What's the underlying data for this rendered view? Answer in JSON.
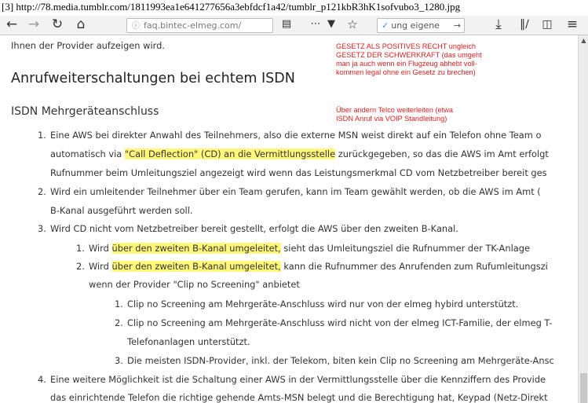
{
  "caption": "[3] http://78.media.tumblr.com/1811993ea1e641277656a3ebfdcf1a42/tumblr_p121kbR3hK1sofvubo3_1280.jpg",
  "browser": {
    "url": "faq.bintec-elmeg.com/",
    "search_text": "ung eigene",
    "icons": [
      "back-icon",
      "forward-icon",
      "reload-icon",
      "home-icon",
      "info-icon",
      "reader-view-icon",
      "menu-dots-icon",
      "pocket-icon",
      "bookmark-star-icon",
      "search-icon",
      "download-icon",
      "library-icon",
      "sidebar-icon",
      "menu-icon"
    ]
  },
  "page": {
    "intro": "Ihnen der Provider aufzeigen wird.",
    "heading": "Anrufweiterschaltungen bei echtem ISDN",
    "subheading": "ISDN Mehrgeräteanschluss",
    "item1": {
      "n": "1.",
      "l1": "Eine AWS bei direkter Anwahl des Teilnehmers, also die externe MSN weist direkt auf ein Telefon ohne Team o",
      "l2_pre": "automatisch via ",
      "l2_hl": "\"Call Deflection\" (CD) an die Vermittlungsstelle",
      "l2_post": " zurückgegeben, so das die AWS im Amt erfolgt",
      "l3": "Rufnummer beim Umleitungsziel angezeigt wird wenn das Leistungsmerkmal CD vom Netzbetreiber bereit ges"
    },
    "item2": {
      "n": "2.",
      "l1": "Wird ein umleitender Teilnehmer über ein Team gerufen, kann im Team gewählt werden, ob die AWS im Amt (",
      "l2": "B-Kanal ausgeführt werden soll."
    },
    "item3": {
      "n": "3.",
      "l1": "Wird CD nicht vom Netzbetreiber bereit gestellt, erfolgt die AWS über den zweiten B-Kanal.",
      "sub1_n": "1.",
      "sub1_pre": "Wird ",
      "sub1_hl": "über den zweiten B-Kanal umgeleitet,",
      "sub1_post": " sieht das Umleitungsziel die Rufnummer der TK-Anlage",
      "sub2_n": "2.",
      "sub2_pre": "Wird ",
      "sub2_hl": "über den zweiten B-Kanal umgeleitet,",
      "sub2_post": " kann die Rufnummer des Anrufenden zum Rufumleitungszi",
      "sub2_l2": "wenn der Provider \"Clip no Screening\" anbietet",
      "ss1_n": "1.",
      "ss1": "Clip no Screening am Mehrgeräte-Anschluss wird nur von der elmeg hybird unterstützt.",
      "ss2_n": "2.",
      "ss2_l1": "Clip no Screening am Mehrgeräte-Anschluss wird nicht von der elmeg ICT-Familie, der elmeg T-",
      "ss2_l2": "Telefonanlagen unterstützt.",
      "ss3_n": "3.",
      "ss3": "Die meisten ISDN-Provider, inkl. der Telekom, biten kein Clip no Screening am Mehrgeräte-Ansc"
    },
    "item4": {
      "n": "4.",
      "l1": "Eine weitere Möglichkeit ist die Schaltung einer AWS in der Vermittlungsstelle über die Kennziffern des Provide",
      "l2": "das einrichtende Telefon die richtige gehende Amts-MSN belegt und die Berechtigung hat, Keypad (Netz-Direkt"
    }
  },
  "annotation": {
    "lines1": [
      "GESETZ ALS POSITIVES RECHT ungleich",
      "GESETZ DER SCHWERKRAFT (das umgeht",
      "man ja auch wenn ein Flugzeug abhebt voll-",
      "kommen legal ohne ein Gesetz zu brechen)"
    ],
    "lines2": [
      "Über andern Telco weiterleiten (etwa",
      "ISDN Anruf via VOIP Standleitung)"
    ],
    "color": "#d82020"
  },
  "colors": {
    "highlight": "#fff87a",
    "text": "#333333"
  }
}
